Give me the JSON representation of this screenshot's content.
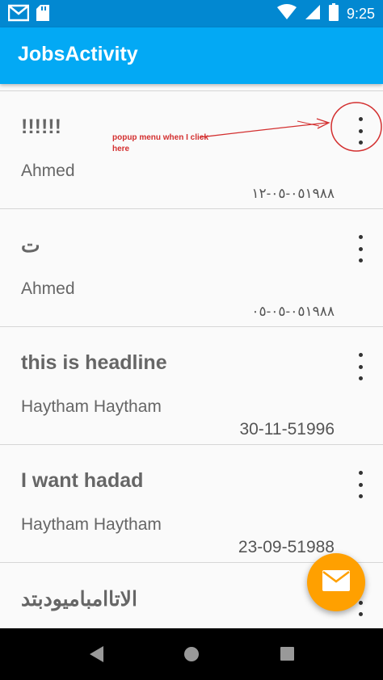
{
  "status_bar": {
    "time": "9:25",
    "left_icons": [
      "gmail-icon",
      "sd-card-icon"
    ],
    "right_icons": [
      "wifi-icon",
      "signal-icon",
      "battery-icon"
    ]
  },
  "app_bar": {
    "title": "JobsActivity"
  },
  "annotation": {
    "text": "popup menu when I click here",
    "color": "#d32f2f"
  },
  "jobs": [
    {
      "title": "!!!!!!",
      "author": "Ahmed",
      "date": "٠٥١٩٨٨-٠٥-١٢",
      "date_script": "arabic",
      "more_icon": "more-vert-icon"
    },
    {
      "title": "ت",
      "author": "Ahmed",
      "date": "٠٥١٩٨٨-٠٥-٠٥",
      "date_script": "arabic",
      "more_icon": "more-vert-icon"
    },
    {
      "title": "this is headline",
      "author": "Haytham Haytham",
      "date": "30-11-51996",
      "date_script": "latin",
      "more_icon": "more-vert-icon"
    },
    {
      "title": "I want hadad",
      "author": "Haytham Haytham",
      "date": "23-09-51988",
      "date_script": "latin",
      "more_icon": "more-vert-icon"
    },
    {
      "title": "الاتاامباميودبتد",
      "author": "",
      "date": "",
      "date_script": "latin",
      "more_icon": "more-vert-icon"
    }
  ],
  "fab": {
    "icon": "email-icon",
    "color": "#ffa000"
  },
  "nav_bar": {
    "buttons": [
      "back-icon",
      "home-icon",
      "recents-icon"
    ]
  },
  "colors": {
    "status_bar": "#0288d1",
    "app_bar": "#03a9f4",
    "fab": "#ffa000"
  }
}
